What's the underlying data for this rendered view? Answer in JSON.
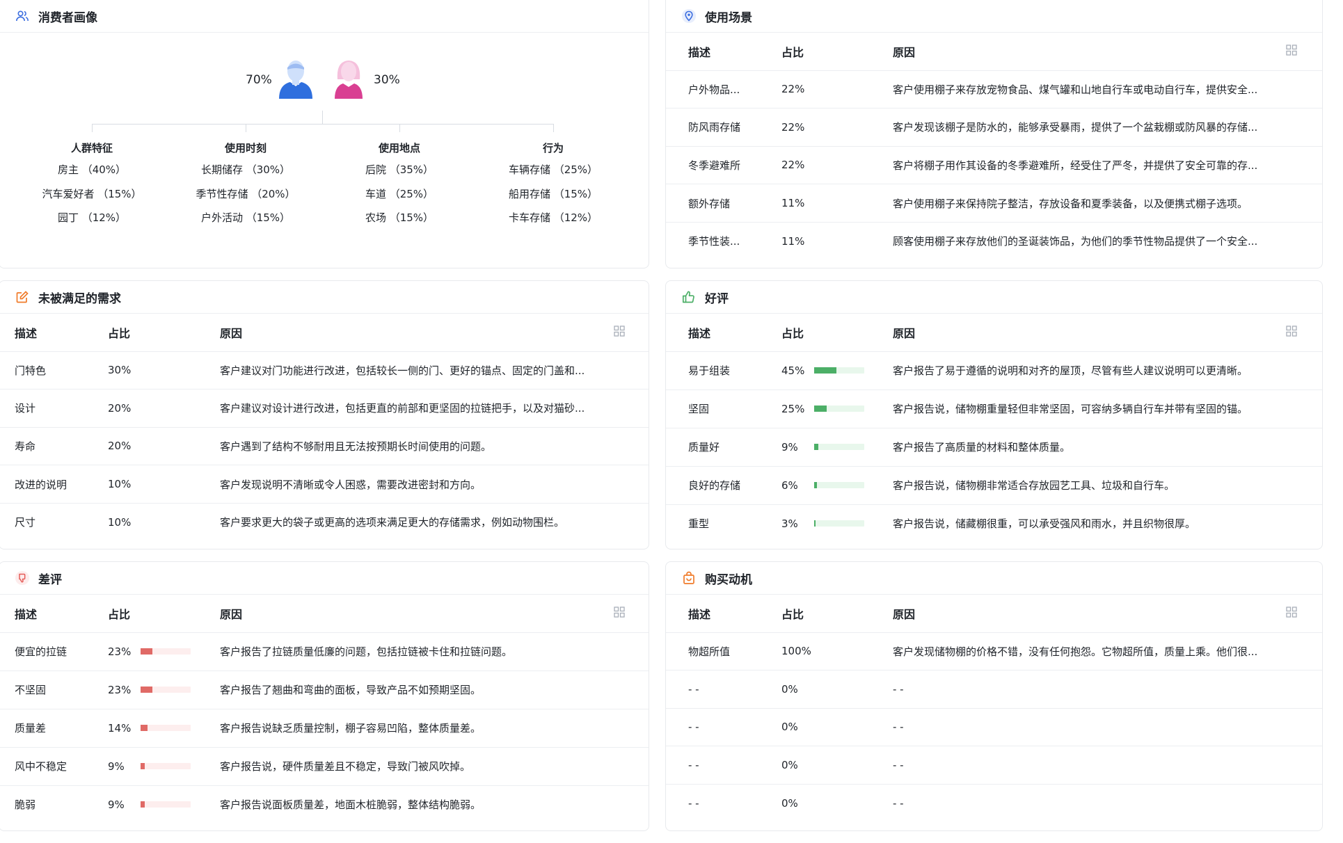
{
  "persona": {
    "title": "消费者画像",
    "male_pct": "70%",
    "female_pct": "30%",
    "columns": [
      {
        "title": "人群特征",
        "items": [
          "房主 （40%）",
          "汽车爱好者 （15%）",
          "园丁 （12%）"
        ]
      },
      {
        "title": "使用时刻",
        "items": [
          "长期储存 （30%）",
          "季节性存储 （20%）",
          "户外活动 （15%）"
        ]
      },
      {
        "title": "使用地点",
        "items": [
          "后院 （35%）",
          "车道 （25%）",
          "农场 （15%）"
        ]
      },
      {
        "title": "行为",
        "items": [
          "车辆存储 （25%）",
          "船用存储 （15%）",
          "卡车存储 （12%）"
        ]
      }
    ]
  },
  "scenes": {
    "title": "使用场景",
    "headers": [
      "描述",
      "占比",
      "原因"
    ],
    "rows": [
      {
        "desc": "户外物品...",
        "pct": "22%",
        "reason": "客户使用棚子来存放宠物食品、煤气罐和山地自行车或电动自行车，提供安全..."
      },
      {
        "desc": "防风雨存储",
        "pct": "22%",
        "reason": "客户发现该棚子是防水的，能够承受暴雨，提供了一个盆栽棚或防风暴的存储..."
      },
      {
        "desc": "冬季避难所",
        "pct": "22%",
        "reason": "客户将棚子用作其设备的冬季避难所，经受住了严冬，并提供了安全可靠的存..."
      },
      {
        "desc": "额外存储",
        "pct": "11%",
        "reason": "客户使用棚子来保持院子整洁，存放设备和夏季装备，以及便携式棚子选项。"
      },
      {
        "desc": "季节性装...",
        "pct": "11%",
        "reason": "顾客使用棚子来存放他们的圣诞装饰品，为他们的季节性物品提供了一个安全..."
      }
    ]
  },
  "unmet": {
    "title": "未被满足的需求",
    "headers": [
      "描述",
      "占比",
      "原因"
    ],
    "rows": [
      {
        "desc": "门特色",
        "pct": "30%",
        "reason": "客户建议对门功能进行改进，包括较长一侧的门、更好的锚点、固定的门盖和..."
      },
      {
        "desc": "设计",
        "pct": "20%",
        "reason": "客户建议对设计进行改进，包括更直的前部和更坚固的拉链把手，以及对猫砂..."
      },
      {
        "desc": "寿命",
        "pct": "20%",
        "reason": "客户遇到了结构不够耐用且无法按预期长时间使用的问题。"
      },
      {
        "desc": "改进的说明",
        "pct": "10%",
        "reason": "客户发现说明不清晰或令人困惑，需要改进密封和方向。"
      },
      {
        "desc": "尺寸",
        "pct": "10%",
        "reason": "客户要求更大的袋子或更高的选项来满足更大的存储需求，例如动物围栏。"
      }
    ]
  },
  "positive": {
    "title": "好评",
    "headers": [
      "描述",
      "占比",
      "原因"
    ],
    "bar_color": "#4caf67",
    "track_color": "#e8f7ec",
    "rows": [
      {
        "desc": "易于组装",
        "pct": "45%",
        "value": 0.45,
        "reason": "客户报告了易于遵循的说明和对齐的屋顶，尽管有些人建议说明可以更清晰。"
      },
      {
        "desc": "坚固",
        "pct": "25%",
        "value": 0.25,
        "reason": "客户报告说，储物棚重量轻但非常坚固，可容纳多辆自行车并带有坚固的锚。"
      },
      {
        "desc": "质量好",
        "pct": "9%",
        "value": 0.09,
        "reason": "客户报告了高质量的材料和整体质量。"
      },
      {
        "desc": "良好的存储",
        "pct": "6%",
        "value": 0.06,
        "reason": "客户报告说，储物棚非常适合存放园艺工具、垃圾和自行车。"
      },
      {
        "desc": "重型",
        "pct": "3%",
        "value": 0.03,
        "reason": "客户报告说，储藏棚很重，可以承受强风和雨水，并且织物很厚。"
      }
    ]
  },
  "negative": {
    "title": "差评",
    "headers": [
      "描述",
      "占比",
      "原因"
    ],
    "bar_color": "#e06a66",
    "track_color": "#fdeeee",
    "rows": [
      {
        "desc": "便宜的拉链",
        "pct": "23%",
        "value": 0.23,
        "reason": "客户报告了拉链质量低廉的问题，包括拉链被卡住和拉链问题。"
      },
      {
        "desc": "不坚固",
        "pct": "23%",
        "value": 0.23,
        "reason": "客户报告了翘曲和弯曲的面板，导致产品不如预期坚固。"
      },
      {
        "desc": "质量差",
        "pct": "14%",
        "value": 0.14,
        "reason": "客户报告说缺乏质量控制，棚子容易凹陷，整体质量差。"
      },
      {
        "desc": "风中不稳定",
        "pct": "9%",
        "value": 0.09,
        "reason": "客户报告说，硬件质量差且不稳定，导致门被风吹掉。"
      },
      {
        "desc": "脆弱",
        "pct": "9%",
        "value": 0.09,
        "reason": "客户报告说面板质量差，地面木桩脆弱，整体结构脆弱。"
      }
    ]
  },
  "motive": {
    "title": "购买动机",
    "headers": [
      "描述",
      "占比",
      "原因"
    ],
    "rows": [
      {
        "desc": "物超所值",
        "pct": "100%",
        "reason": "客户发现储物棚的价格不错，没有任何抱怨。它物超所值，质量上乘。他们很..."
      },
      {
        "desc": "- -",
        "pct": "0%",
        "reason": "- -"
      },
      {
        "desc": "- -",
        "pct": "0%",
        "reason": "- -"
      },
      {
        "desc": "- -",
        "pct": "0%",
        "reason": "- -"
      },
      {
        "desc": "- -",
        "pct": "0%",
        "reason": "- -"
      }
    ]
  },
  "colors": {
    "male": "#2f6fde",
    "female": "#e0489a",
    "orange": "#f07b2a",
    "blue": "#3d6fe0",
    "green": "#4caf67",
    "red": "#e55c58"
  },
  "icons": {
    "persona": "users-icon",
    "scenes": "location-pin-icon",
    "unmet": "edit-icon",
    "positive": "thumbs-up-icon",
    "negative": "thumbs-down-icon",
    "motive": "shopping-bag-icon",
    "table": "grid-icon"
  }
}
